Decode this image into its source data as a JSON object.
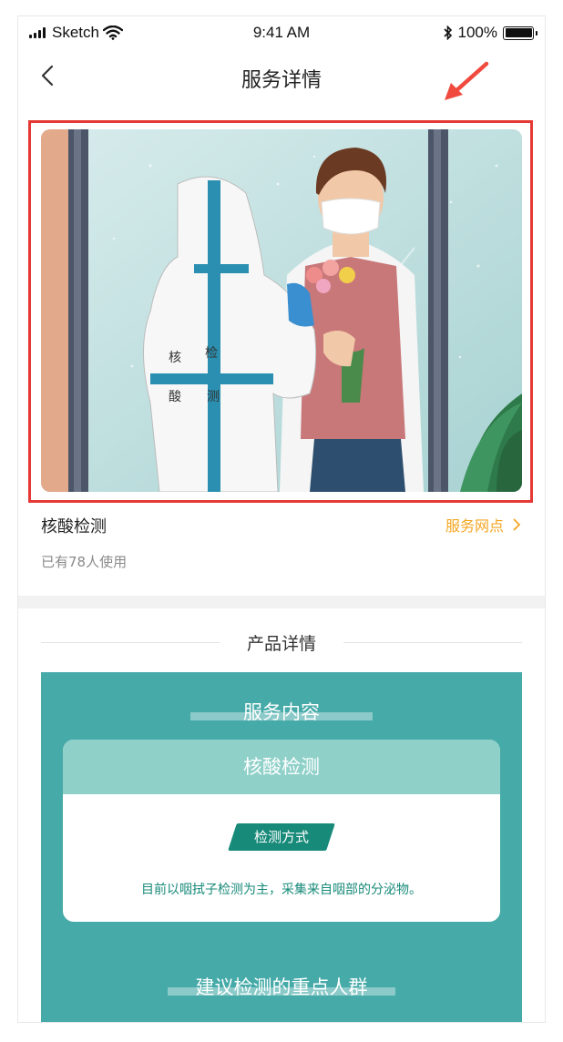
{
  "status": {
    "carrier": "Sketch",
    "time": "9:41 AM",
    "battery": "100%"
  },
  "nav": {
    "title": "服务详情"
  },
  "service": {
    "name": "核酸检测",
    "link": "服务网点",
    "users": "已有78人使用",
    "hero_suit_text": [
      "核",
      "检",
      "酸",
      "测"
    ]
  },
  "detail": {
    "header": "产品详情",
    "section1": "服务内容",
    "card_title": "核酸检测",
    "method_tag": "检测方式",
    "method_desc": "目前以咽拭子检测为主，采集来自咽部的分泌物。",
    "section2": "建议检测的重点人群"
  },
  "colors": {
    "accent": "#f5a623",
    "teal": "#45aaa8",
    "teal_light": "#8fd0c9",
    "teal_dark": "#178a79",
    "highlight": "#e53935"
  },
  "icons": {
    "back": "chevron-left-icon",
    "link": "chevron-right-icon",
    "annotation": "red-arrow-icon"
  }
}
